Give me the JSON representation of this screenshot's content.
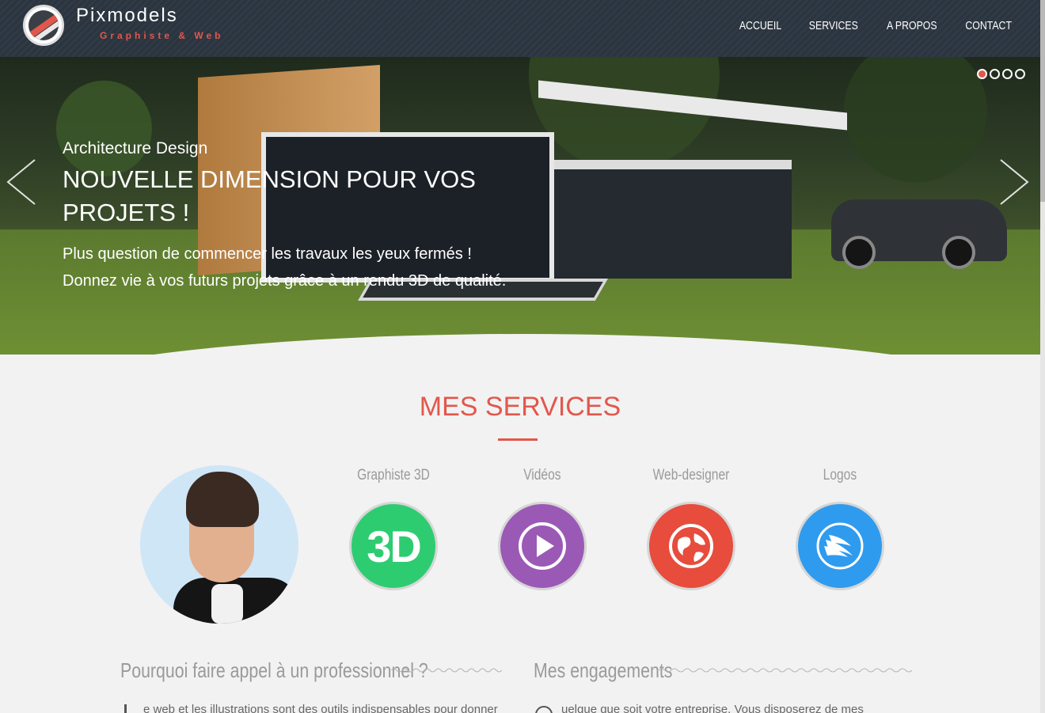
{
  "brand": {
    "name": "Pixmodels",
    "tagline": "Graphiste & Web"
  },
  "nav": {
    "items": [
      "ACCUEIL",
      "SERVICES",
      "A PROPOS",
      "CONTACT"
    ]
  },
  "hero": {
    "subtitle": "Architecture Design",
    "title": "NOUVELLE DIMENSION POUR VOS PROJETS !",
    "text": "Plus question de commencer les travaux les yeux fermés ! Donnez vie à vos futurs projets grâce à un rendu 3D de qualité.",
    "slides_total": 4,
    "active_slide": 1
  },
  "services": {
    "title": "MES SERVICES",
    "items": [
      {
        "label": "Graphiste 3D",
        "icon": "3d-text-icon",
        "icon_text": "3D",
        "color": "#2ecc71"
      },
      {
        "label": "Vidéos",
        "icon": "play-icon",
        "color": "#9b59b6"
      },
      {
        "label": "Web-designer",
        "icon": "globe-icon",
        "color": "#e74c3c"
      },
      {
        "label": "Logos",
        "icon": "bird-logo-icon",
        "color": "#2f9bef"
      }
    ]
  },
  "sections": {
    "why_title": "Pourquoi faire appel à un professionnel ?",
    "why_text": "e web et les illustrations sont des outils indispensables pour donner",
    "commit_title": "Mes engagements",
    "commit_text": "uelque que soit votre entreprise. Vous disposerez de mes"
  },
  "colors": {
    "accent": "#e2574c",
    "header_bg": "#2b3540",
    "page_bg": "#f2f2f2"
  }
}
